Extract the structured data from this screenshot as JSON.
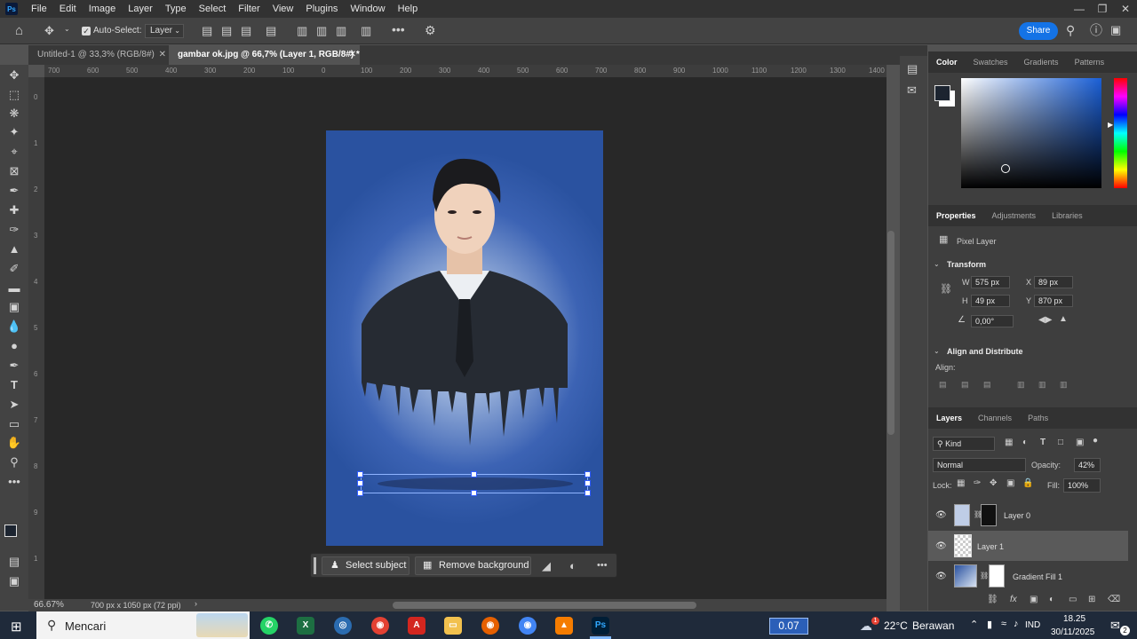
{
  "app": {
    "logo_text": "Ps"
  },
  "menu": [
    "File",
    "Edit",
    "Image",
    "Layer",
    "Type",
    "Select",
    "Filter",
    "View",
    "Plugins",
    "Window",
    "Help"
  ],
  "options": {
    "auto_select_label": "Auto-Select:",
    "auto_select_checked": true,
    "layer_dropdown": "Layer",
    "share_label": "Share"
  },
  "tabs": [
    {
      "title": "Untitled-1 @ 33,3% (RGB/8#)",
      "active": false
    },
    {
      "title": "gambar ok.jpg @ 66,7% (Layer 1, RGB/8#) *",
      "active": true
    }
  ],
  "ruler_top_labels": [
    "700",
    "600",
    "500",
    "400",
    "300",
    "200",
    "100",
    "0",
    "100",
    "200",
    "300",
    "400",
    "500",
    "600",
    "700",
    "800",
    "900",
    "1000",
    "1100",
    "1200",
    "1300",
    "1400"
  ],
  "ruler_left_labels": [
    "0",
    "1",
    "2",
    "3",
    "4",
    "5",
    "6",
    "7",
    "8",
    "9",
    "1"
  ],
  "status": {
    "zoom": "66.67%",
    "doc_info": "700 px x 1050 px (72 ppi)"
  },
  "context_bar": {
    "select_subject": "Select subject",
    "remove_background": "Remove background"
  },
  "color_panel": {
    "tabs": [
      "Color",
      "Swatches",
      "Gradients",
      "Patterns"
    ],
    "fg_color": "#1c2430",
    "bg_color": "#ffffff",
    "hue_color": "#1a5fd6"
  },
  "properties": {
    "tabs": [
      "Properties",
      "Adjustments",
      "Libraries"
    ],
    "layer_kind": "Pixel Layer",
    "transform_title": "Transform",
    "w_label": "W",
    "w_value": "575 px",
    "h_label": "H",
    "h_value": "49 px",
    "x_label": "X",
    "x_value": "89 px",
    "y_label": "Y",
    "y_value": "870 px",
    "angle_value": "0,00°",
    "align_title": "Align and Distribute",
    "align_label": "Align:"
  },
  "layers_panel": {
    "tabs": [
      "Layers",
      "Channels",
      "Paths"
    ],
    "filter_kind": "Kind",
    "blend_mode": "Normal",
    "opacity_label": "Opacity:",
    "opacity_value": "42%",
    "lock_label": "Lock:",
    "fill_label": "Fill:",
    "fill_value": "100%",
    "layers": [
      {
        "name": "Layer 0",
        "selected": false
      },
      {
        "name": "Layer 1",
        "selected": true
      },
      {
        "name": "Gradient Fill 1",
        "selected": false
      }
    ]
  },
  "taskbar": {
    "search_placeholder": "Mencari",
    "speed_readout": "0.07",
    "weather_temp": "22°C",
    "weather_desc": "Berawan",
    "weather_badge": "1",
    "lang": "IND",
    "time": "18.25",
    "date": "30/11/2025",
    "notification_count": "2"
  }
}
